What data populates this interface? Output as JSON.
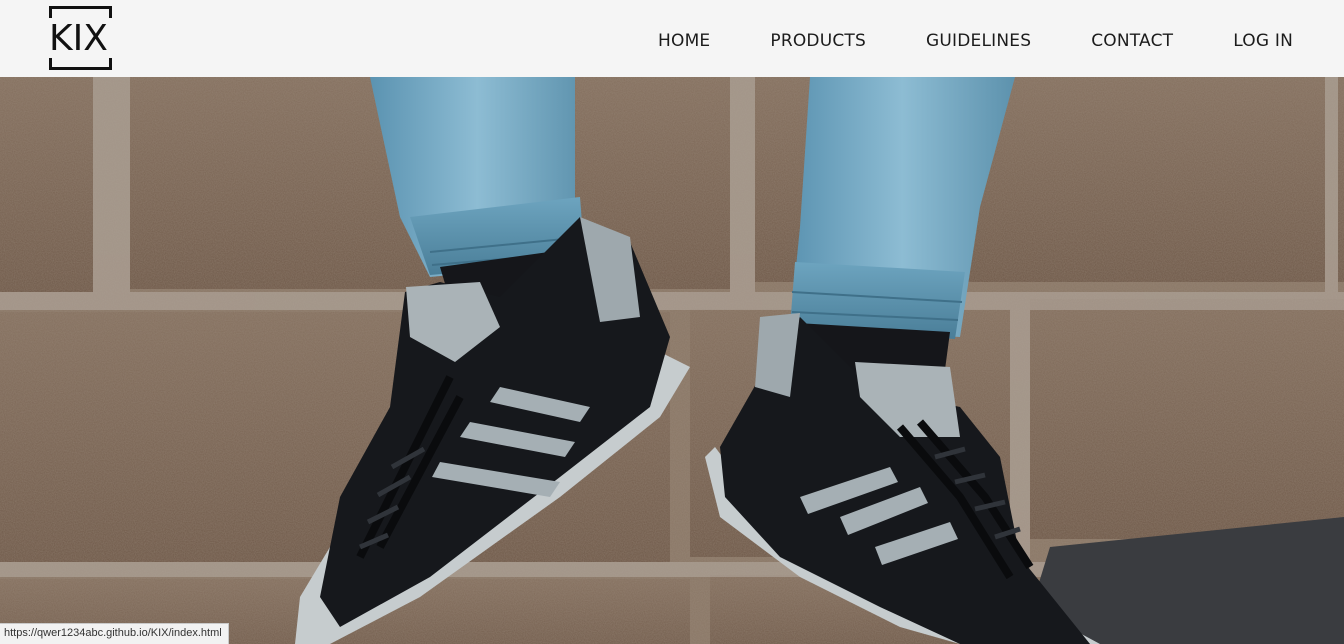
{
  "brand": {
    "logo_text": "KIX"
  },
  "nav": {
    "items": [
      {
        "label": "HOME"
      },
      {
        "label": "PRODUCTS"
      },
      {
        "label": "GUIDELINES"
      },
      {
        "label": "CONTACT"
      },
      {
        "label": "LOG IN"
      }
    ]
  },
  "hero": {
    "image_icon": "sneakers-photo"
  },
  "statusbar": {
    "url": "https://qwer1234abc.github.io/KIX/index.html"
  },
  "colors": {
    "header_bg": "#f5f5f5",
    "text": "#1c1c1c",
    "brick": "#7d6553",
    "mortar": "#a79f97",
    "denim": "#6aa0bb",
    "shoe": "#15171b",
    "stripe": "#a7b1b6"
  }
}
